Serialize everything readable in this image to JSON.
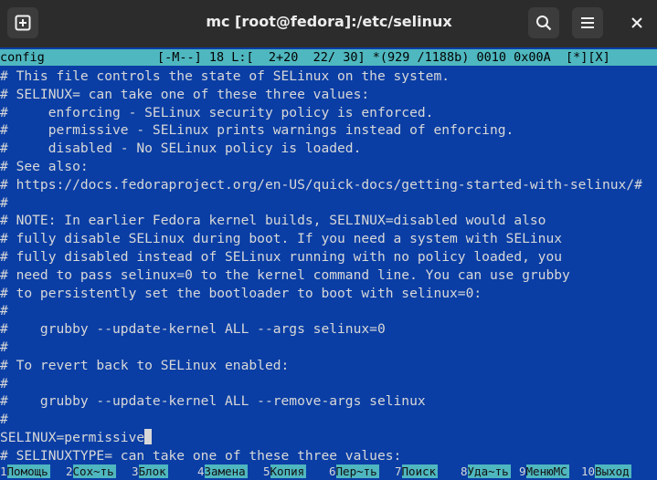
{
  "window": {
    "title": "mc [root@fedora]:/etc/selinux"
  },
  "icons": {
    "new_tab": "new-tab-icon",
    "search": "search-icon",
    "menu": "hamburger-menu-icon",
    "close": "close-icon"
  },
  "statusbar": {
    "filename": "config",
    "info": "[-M--] 18 L:[  2+20  22/ 30] *(929 /1188b) 0010 0x00A  [*][X]"
  },
  "editor": {
    "lines": [
      "# This file controls the state of SELinux on the system.",
      "# SELINUX= can take one of these three values:",
      "#     enforcing - SELinux security policy is enforced.",
      "#     permissive - SELinux prints warnings instead of enforcing.",
      "#     disabled - No SELinux policy is loaded.",
      "# See also:",
      "# https://docs.fedoraproject.org/en-US/quick-docs/getting-started-with-selinux/#",
      "#",
      "# NOTE: In earlier Fedora kernel builds, SELINUX=disabled would also",
      "# fully disable SELinux during boot. If you need a system with SELinux",
      "# fully disabled instead of SELinux running with no policy loaded, you",
      "# need to pass selinux=0 to the kernel command line. You can use grubby",
      "# to persistently set the bootloader to boot with selinux=0:",
      "#",
      "#    grubby --update-kernel ALL --args selinux=0",
      "#",
      "# To revert back to SELinux enabled:",
      "#",
      "#    grubby --update-kernel ALL --remove-args selinux",
      "#",
      "SELINUX=permissive",
      "# SELINUXTYPE= can take one of these three values:"
    ]
  },
  "fkeys": [
    {
      "num": "1",
      "label": "Помощь"
    },
    {
      "num": "2",
      "label": "Сох~ть"
    },
    {
      "num": "3",
      "label": "Блок"
    },
    {
      "num": "4",
      "label": "Замена"
    },
    {
      "num": "5",
      "label": "Копия"
    },
    {
      "num": "6",
      "label": "Пер~ть"
    },
    {
      "num": "7",
      "label": "Поиск"
    },
    {
      "num": "8",
      "label": "Уда~ть"
    },
    {
      "num": "9",
      "label": "МенюMC"
    },
    {
      "num": "10",
      "label": "Выход"
    }
  ]
}
